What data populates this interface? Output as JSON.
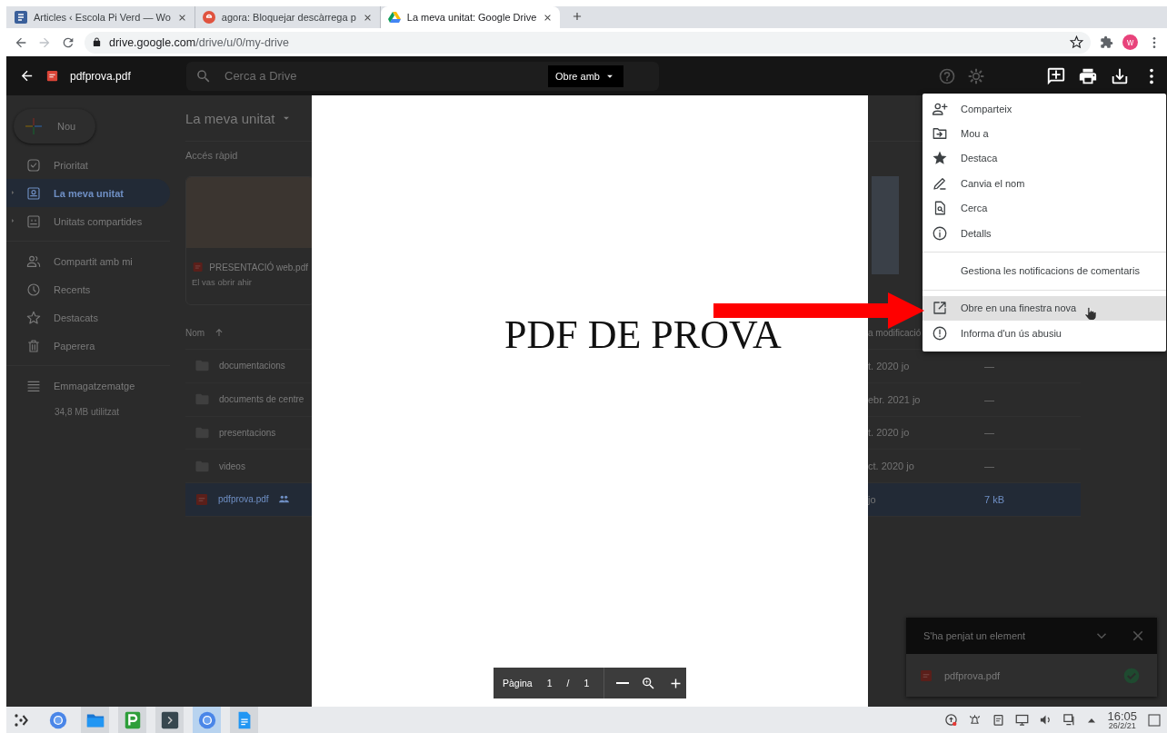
{
  "browser": {
    "tabs": [
      {
        "title": "Articles ‹ Escola Pi Verd — Wo",
        "selected": false
      },
      {
        "title": "agora: Bloquejar descàrrega p",
        "selected": false
      },
      {
        "title": "La meva unitat: Google Drive",
        "selected": true
      }
    ],
    "address": {
      "host": "drive.google.com",
      "path": "/drive/u/0/my-drive"
    },
    "profile_initial": "w"
  },
  "drive": {
    "search_placeholder": "Cerca a Drive",
    "new_button": "Nou",
    "sidebar": {
      "sections": [
        {
          "items": [
            {
              "label": "Prioritat",
              "selected": false,
              "expandable": false
            },
            {
              "label": "La meva unitat",
              "selected": true,
              "expandable": true
            },
            {
              "label": "Unitats compartides",
              "selected": false,
              "expandable": true
            }
          ]
        },
        {
          "items": [
            {
              "label": "Compartit amb mi",
              "selected": false,
              "expandable": false
            },
            {
              "label": "Recents",
              "selected": false,
              "expandable": false
            },
            {
              "label": "Destacats",
              "selected": false,
              "expandable": false
            },
            {
              "label": "Paperera",
              "selected": false,
              "expandable": false
            }
          ]
        }
      ]
    },
    "storage": {
      "label": "Emmagatzematge",
      "usage": "34,8 MB utilitzat"
    },
    "location": "La meva unitat",
    "quick_access": {
      "heading": "Accés ràpid",
      "cards": [
        {
          "name": "PRESENTACIÓ web.pdf",
          "subtitle": "El vas obrir ahir"
        }
      ]
    },
    "list": {
      "columns": [
        "Nom",
        "a modificació"
      ],
      "rows": [
        {
          "name": "documentacions",
          "kind": "folder",
          "shared": false,
          "selected": false,
          "modified": "t. 2020 jo",
          "size": "—"
        },
        {
          "name": "documents de centre",
          "kind": "folder",
          "shared": false,
          "selected": false,
          "modified": "ebr. 2021 jo",
          "size": "—"
        },
        {
          "name": "presentacions",
          "kind": "folder",
          "shared": false,
          "selected": false,
          "modified": "t. 2020 jo",
          "size": "—"
        },
        {
          "name": "videos",
          "kind": "folder",
          "shared": false,
          "selected": false,
          "modified": "ct. 2020 jo",
          "size": "—"
        },
        {
          "name": "pdfprova.pdf",
          "kind": "pdf",
          "shared": true,
          "selected": true,
          "modified": "jo",
          "size": "7 kB"
        }
      ]
    }
  },
  "viewer": {
    "file_name": "pdfprova.pdf",
    "open_with": "Obre amb",
    "page_text": "PDF DE PROVA",
    "pager": {
      "label": "Pàgina",
      "current": "1",
      "separator": "/",
      "total": "1"
    }
  },
  "menu": {
    "sections": [
      {
        "items": [
          {
            "label": "Comparteix",
            "highlighted": false
          },
          {
            "label": "Mou a",
            "highlighted": false
          },
          {
            "label": "Destaca",
            "highlighted": false
          },
          {
            "label": "Canvia el nom",
            "highlighted": false
          },
          {
            "label": "Cerca",
            "highlighted": false
          },
          {
            "label": "Detalls",
            "highlighted": false
          }
        ]
      },
      {
        "items": [
          {
            "label": "Gestiona les notificacions de comentaris",
            "highlighted": false
          }
        ]
      },
      {
        "items": [
          {
            "label": "Obre en una finestra nova",
            "highlighted": true
          },
          {
            "label": "Informa d'un ús abusiu",
            "highlighted": false
          }
        ]
      }
    ]
  },
  "upload": {
    "title": "S'ha penjat un element",
    "files": [
      {
        "name": "pdfprova.pdf",
        "done": true
      }
    ]
  },
  "taskbar": {
    "time": "16:05",
    "date": "26/2/21"
  }
}
